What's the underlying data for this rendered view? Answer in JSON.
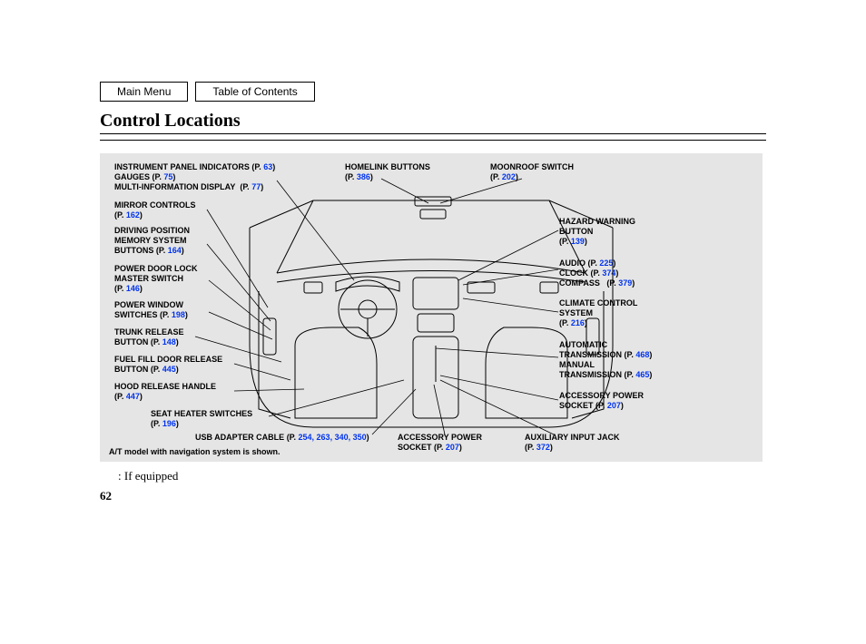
{
  "nav": {
    "main_menu": "Main Menu",
    "toc": "Table of Contents"
  },
  "title": "Control Locations",
  "labels": {
    "instrument_panel": "INSTRUMENT PANEL INDICATORS",
    "instrument_panel_pg": "63",
    "gauges": "GAUGES",
    "gauges_pg": "75",
    "mid": "MULTI-INFORMATION DISPLAY",
    "mid_pg": "77",
    "mirror": "MIRROR CONTROLS",
    "mirror_pg": "162",
    "driving_pos_1": "DRIVING POSITION",
    "driving_pos_2": "MEMORY SYSTEM",
    "driving_pos_3": "BUTTONS",
    "driving_pos_pg": "164",
    "doorlock_1": "POWER DOOR LOCK",
    "doorlock_2": "MASTER SWITCH",
    "doorlock_pg": "146",
    "pwin_1": "POWER WINDOW",
    "pwin_2": "SWITCHES",
    "pwin_pg": "198",
    "trunk_1": "TRUNK RELEASE",
    "trunk_2": "BUTTON",
    "trunk_pg": "148",
    "fuelfill_1": "FUEL FILL DOOR RELEASE",
    "fuelfill_2": "BUTTON",
    "fuelfill_pg": "445",
    "hood": "HOOD RELEASE HANDLE",
    "hood_pg": "447",
    "seatheat": "SEAT HEATER SWITCHES",
    "seatheat_pg": "196",
    "usb": "USB ADAPTER CABLE",
    "usb_pg": "254, 263, 340, 350",
    "accpower": "ACCESSORY POWER",
    "accpower2": "SOCKET",
    "accpower_pg": "207",
    "aux": "AUXILIARY INPUT JACK",
    "aux_pg": "372",
    "homelink": "HOMELINK BUTTONS",
    "homelink_pg": "386",
    "moonroof": "MOONROOF SWITCH",
    "moonroof_pg": "202",
    "hazard_1": "HAZARD WARNING",
    "hazard_2": "BUTTON",
    "hazard_pg": "139",
    "audio": "AUDIO",
    "audio_pg": "225",
    "clock": "CLOCK",
    "clock_pg": "374",
    "compass": "COMPASS",
    "compass_pg": "379",
    "climate_1": "CLIMATE CONTROL",
    "climate_2": "SYSTEM",
    "climate_pg": "216",
    "auto_trans_1": "AUTOMATIC",
    "auto_trans_2": "TRANSMISSION",
    "auto_trans_pg": "468",
    "man_trans_1": "MANUAL",
    "man_trans_2": "TRANSMISSION",
    "man_trans_pg": "465",
    "accpower_r_1": "ACCESSORY POWER",
    "accpower_r_2": "SOCKET",
    "accpower_r_pg": "207"
  },
  "footnote_model": "A/T model with navigation system is shown.",
  "if_equipped": ":  If equipped",
  "page_number": "62",
  "pprefix": "(P. ",
  "pprefix2": "(P.",
  "psuffix": ")"
}
